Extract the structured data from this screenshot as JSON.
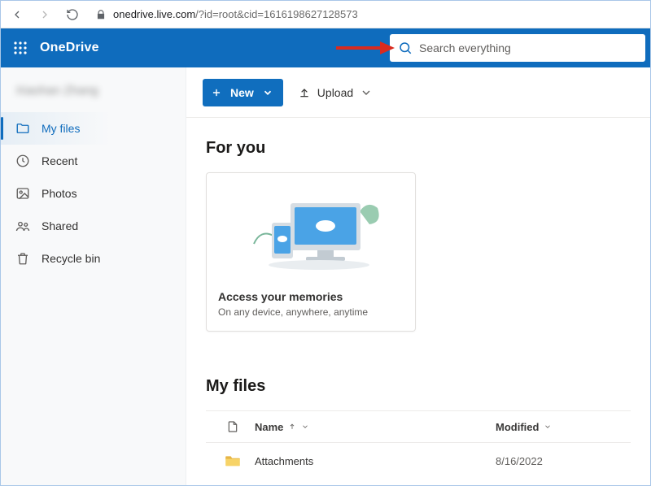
{
  "browser": {
    "url_host": "onedrive.live.com",
    "url_path": "/?id=root&cid=1616198627128573"
  },
  "header": {
    "app_title": "OneDrive",
    "search_placeholder": "Search everything"
  },
  "sidebar": {
    "user_name": "Xiaohan Zhang",
    "items": [
      {
        "label": "My files"
      },
      {
        "label": "Recent"
      },
      {
        "label": "Photos"
      },
      {
        "label": "Shared"
      },
      {
        "label": "Recycle bin"
      }
    ]
  },
  "toolbar": {
    "new_label": "New",
    "upload_label": "Upload"
  },
  "for_you": {
    "heading": "For you",
    "card_title": "Access your memories",
    "card_subtitle": "On any device, anywhere, anytime"
  },
  "files": {
    "heading": "My files",
    "col_name": "Name",
    "col_modified": "Modified",
    "rows": [
      {
        "name": "Attachments",
        "modified": "8/16/2022"
      }
    ]
  }
}
